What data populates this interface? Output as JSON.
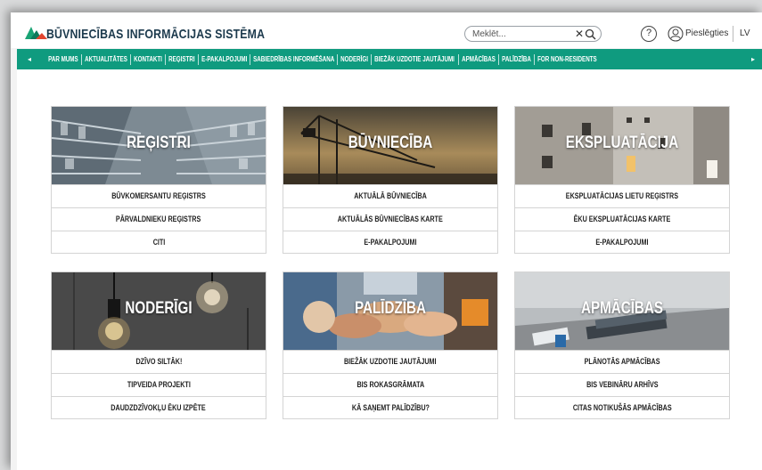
{
  "header": {
    "site_title": "BŪVNIECĪBAS INFORMĀCIJAS SISTĒMA",
    "search_placeholder": "Meklēt...",
    "clear_symbol": "✕",
    "help_symbol": "?",
    "login_label": "Pieslēgties",
    "language": "LV"
  },
  "nav": {
    "prev_symbol": "◂",
    "next_symbol": "▸",
    "items": [
      "PAR MUMS",
      "AKTUALITĀTES",
      "KONTAKTI",
      "REĢISTRI",
      "E-PAKALPOJUMI",
      "SABIEDRĪBAS INFORMĒŠANA",
      "NODERĪGI",
      "BIEŽĀK UZDOTIE JAUTĀJUMI",
      "APMĀCĪBAS",
      "PALĪDZĪBA",
      "FOR NON-RESIDENTS"
    ]
  },
  "cards": [
    {
      "title": "REĢISTRI",
      "links": [
        "BŪVKOMERSANTU REĢISTRS",
        "PĀRVALDNIEKU REĢISTRS",
        "CITI"
      ]
    },
    {
      "title": "BŪVNIECĪBA",
      "links": [
        "AKTUĀLĀ BŪVNIECĪBA",
        "AKTUĀLĀS BŪVNIECĪBAS KARTE",
        "E-PAKALPOJUMI"
      ]
    },
    {
      "title": "EKSPLUATĀCIJA",
      "links": [
        "EKSPLUATĀCIJAS LIETU REĢISTRS",
        "ĒKU EKSPLUATĀCIJAS KARTE",
        "E-PAKALPOJUMI"
      ]
    },
    {
      "title": "NODERĪGI",
      "links": [
        "DZĪVO SILTĀK!",
        "TIPVEIDA PROJEKTI",
        "DAUDZDZĪVOKĻU ĒKU IZPĒTE"
      ]
    },
    {
      "title": "PALĪDZĪBA",
      "links": [
        "BIEŽĀK UZDOTIE JAUTĀJUMI",
        "BIS ROKASGRĀMATA",
        "KĀ SAŅEMT PALĪDZĪBU?"
      ]
    },
    {
      "title": "APMĀCĪBAS",
      "links": [
        "PLĀNOTĀS APMĀCĪBAS",
        "BIS VEBINĀRU ARHĪVS",
        "CITAS NOTIKUŠĀS APMĀCĪBAS"
      ]
    }
  ],
  "colors": {
    "nav_bg": "#0f9b7f",
    "title_text": "#1c3a4d",
    "logo_green": "#19a374",
    "logo_red": "#e2452f"
  }
}
